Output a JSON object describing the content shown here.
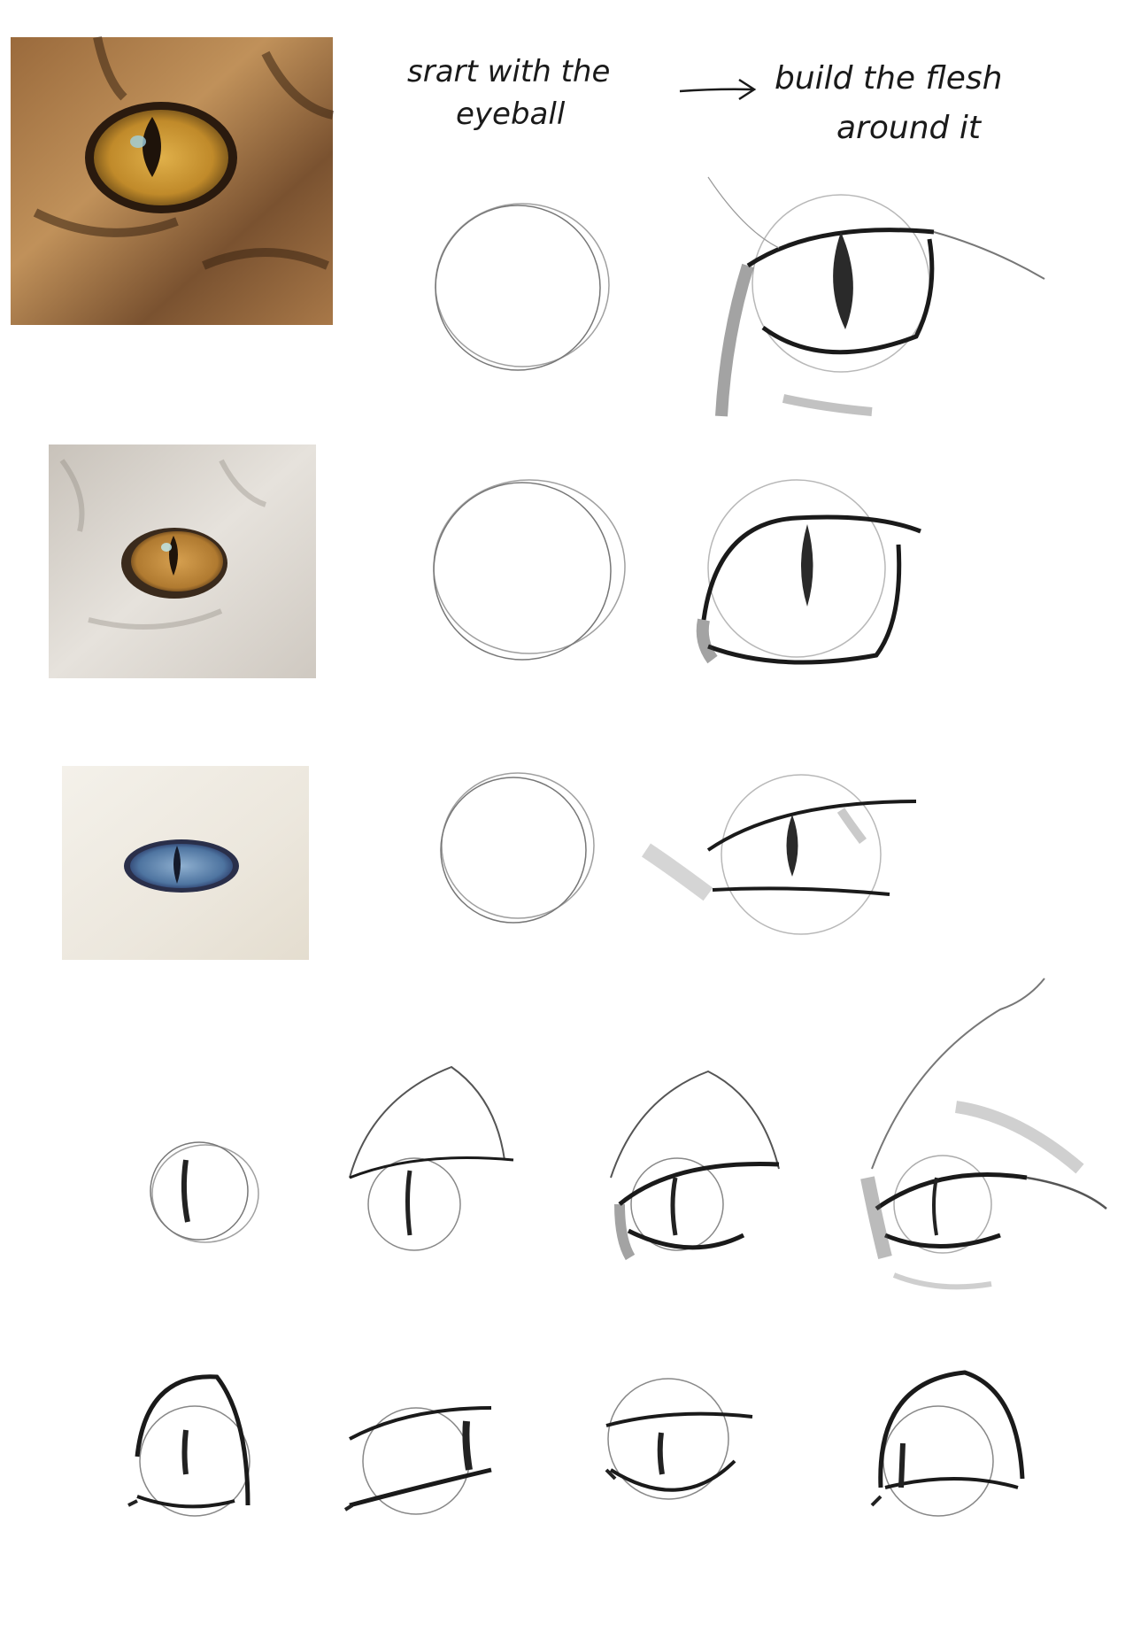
{
  "heading": {
    "left_line1": "srart with the",
    "left_line2": "eyeball",
    "arrow_icon": "arrow-right-icon",
    "right_line1": "build the flesh",
    "right_line2": "around it"
  },
  "colors": {
    "tabby_fur": "#b07a46",
    "tabby_iris": "#c8922e",
    "grey_fur": "#d9d4cd",
    "grey_iris": "#c08a3a",
    "white_fur": "#f2efe8",
    "blue_iris": "#5a7fa8",
    "pencil": "#2b2b2b"
  },
  "photos": [
    {
      "subject": "tabby cat eye photo"
    },
    {
      "subject": "grey cat eye photo"
    },
    {
      "subject": "white cat blue eye photo"
    }
  ]
}
